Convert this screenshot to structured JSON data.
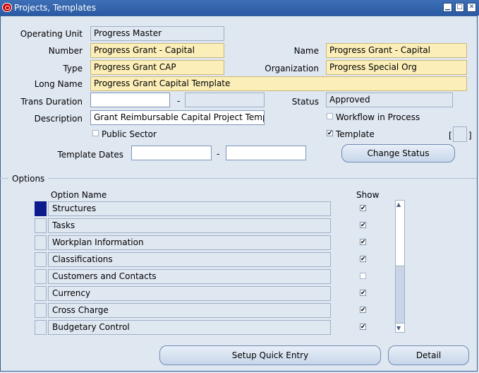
{
  "window": {
    "title": "Projects, Templates"
  },
  "fields": {
    "operating_unit": {
      "label": "Operating Unit",
      "value": "Progress Master"
    },
    "number": {
      "label": "Number",
      "value": "Progress Grant - Capital"
    },
    "name": {
      "label": "Name",
      "value": "Progress Grant - Capital"
    },
    "type": {
      "label": "Type",
      "value": "Progress Grant CAP"
    },
    "organization": {
      "label": "Organization",
      "value": "Progress Special Org"
    },
    "long_name": {
      "label": "Long Name",
      "value": "Progress Grant Capital Template"
    },
    "trans_duration": {
      "label": "Trans Duration",
      "value": "",
      "separator": "-",
      "value2": ""
    },
    "status": {
      "label": "Status",
      "value": "Approved"
    },
    "description": {
      "label": "Description",
      "value": "Grant Reimbursable Capital Project Templ"
    },
    "workflow": {
      "label": "Workflow in Process",
      "checked": false
    },
    "public_sector": {
      "label": "Public Sector",
      "checked": false
    },
    "template": {
      "label": "Template",
      "checked": true
    },
    "template_dates": {
      "label": "Template Dates",
      "from": "",
      "separator": "-",
      "to": ""
    },
    "bracket_open": "[",
    "bracket_close": "]"
  },
  "buttons": {
    "change_status": "Change Status",
    "setup_quick_entry": "Setup Quick Entry",
    "detail": "Detail"
  },
  "options": {
    "section_label": "Options",
    "col_option_name": "Option Name",
    "col_show": "Show",
    "rows": [
      {
        "name": "Structures",
        "show": true,
        "selected": true
      },
      {
        "name": "Tasks",
        "show": true,
        "selected": false
      },
      {
        "name": "Workplan Information",
        "show": true,
        "selected": false
      },
      {
        "name": "Classifications",
        "show": true,
        "selected": false
      },
      {
        "name": "Customers and Contacts",
        "show": false,
        "selected": false
      },
      {
        "name": "Currency",
        "show": true,
        "selected": false
      },
      {
        "name": "Cross Charge",
        "show": true,
        "selected": false
      },
      {
        "name": "Budgetary Control",
        "show": true,
        "selected": false
      }
    ]
  },
  "colors": {
    "title_bar": "#2a5aa3",
    "background": "#dfe7f1",
    "required_field": "#fbeeb8",
    "selected_row": "#0c1c8c"
  }
}
